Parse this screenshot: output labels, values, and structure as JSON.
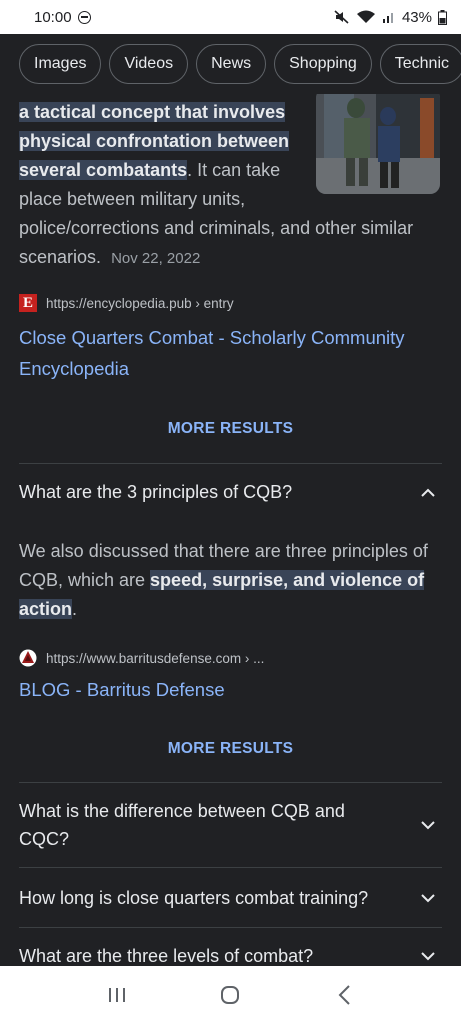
{
  "status": {
    "time": "10:00",
    "battery": "43%"
  },
  "chips": [
    "Images",
    "Videos",
    "News",
    "Shopping",
    "Technic"
  ],
  "result1": {
    "highlight": "a tactical concept that involves physical confrontation between several combatants",
    "rest": ". It can take place between military units, police/corrections and criminals, and other similar scenarios.",
    "date": "Nov 22, 2022",
    "source_url": "https://encyclopedia.pub › entry",
    "favicon_letter": "E",
    "title": "Close Quarters Combat - Scholarly Community Encyclopedia",
    "more": "MORE RESULTS"
  },
  "faq1": {
    "question": "What are the 3 principles of CQB?",
    "answer_pre": "We also discussed that there are three principles of CQB, which are ",
    "answer_highlight": "speed, surprise, and violence of action",
    "answer_post": ".",
    "source_url": "https://www.barritusdefense.com › ...",
    "title": "BLOG - Barritus Defense",
    "more": "MORE RESULTS"
  },
  "faqs": [
    {
      "question": "What is the difference between CQB and CQC?"
    },
    {
      "question": "How long is close quarters combat training?"
    },
    {
      "question": "What are the three levels of combat?"
    }
  ],
  "colors": {
    "background": "#202124",
    "link": "#8ab4f8",
    "highlight": "#394457",
    "favicon": "#c5221f"
  }
}
